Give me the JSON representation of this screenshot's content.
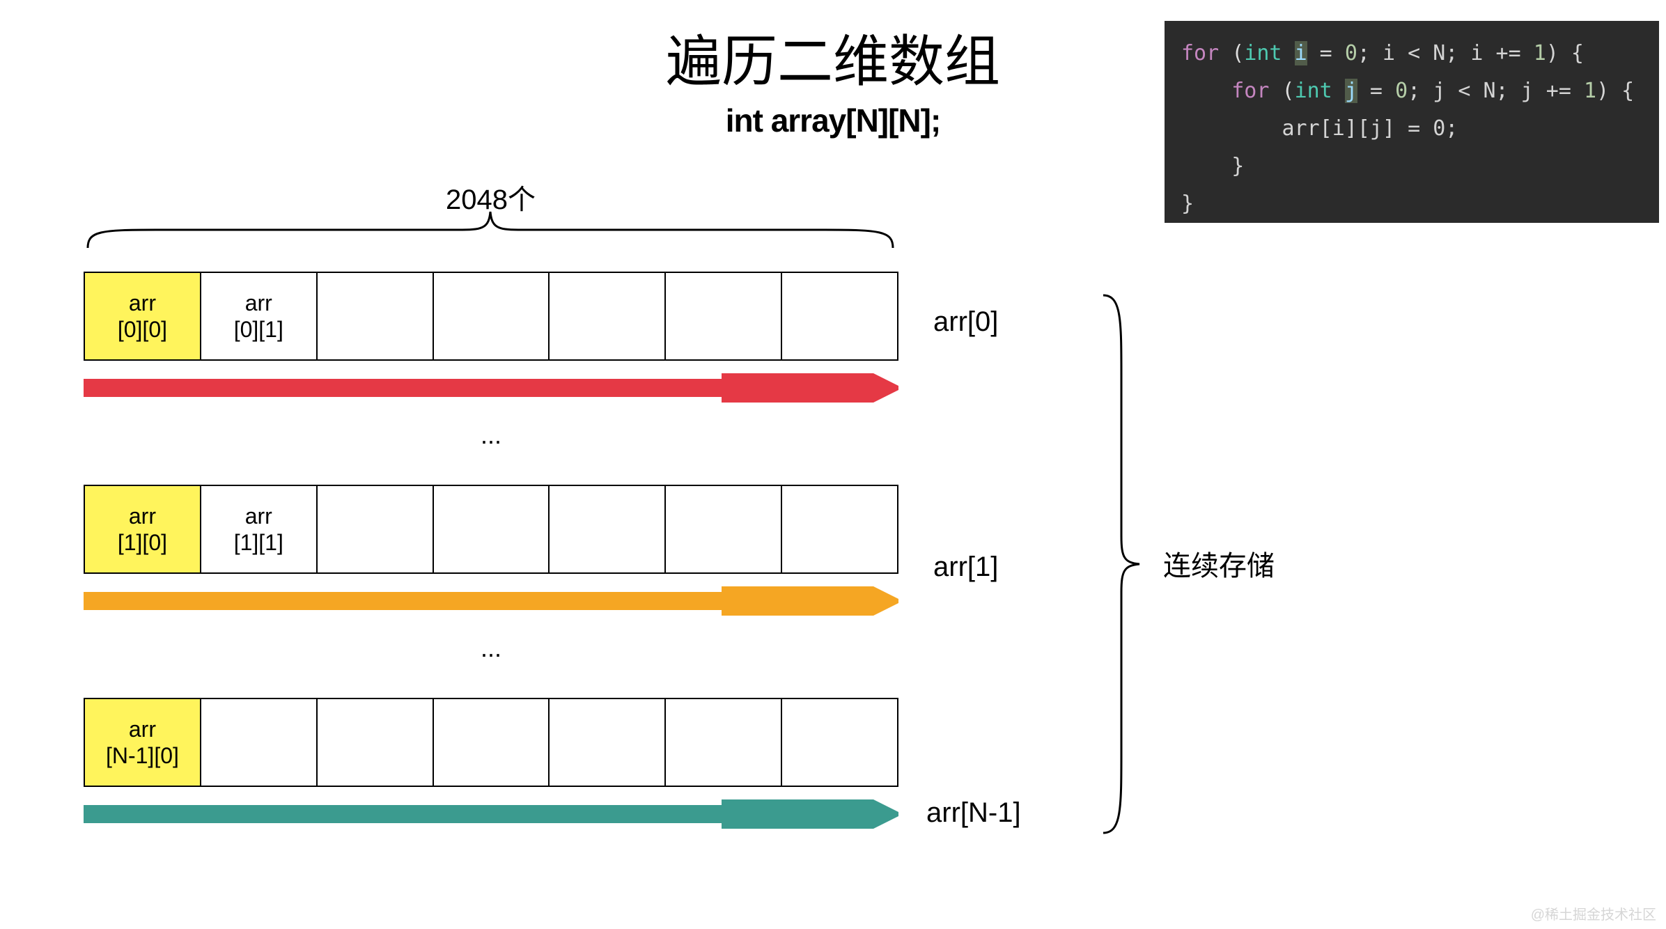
{
  "title": "遍历二维数组",
  "subtitle": "int array[N][N];",
  "size_label": "2048个",
  "storage_label": "连续存储",
  "code": {
    "line1_for": "for",
    "line1_type": "int",
    "line1_var": "i",
    "line1_eq": " = ",
    "line1_zero": "0",
    "line1_cond": "; i < N; i += ",
    "line1_one": "1",
    "line1_end": ") {",
    "line2_for": "for",
    "line2_type": "int",
    "line2_var": "j",
    "line2_eq": " = ",
    "line2_zero": "0",
    "line2_cond": "; j < N; j += ",
    "line2_one": "1",
    "line2_end": ") {",
    "line3_body": "arr[i][j] = 0;",
    "line4": "}",
    "line5": "}"
  },
  "rows": [
    {
      "cells": [
        "arr [0][0]",
        "arr [0][1]",
        "",
        "",
        "",
        "",
        ""
      ],
      "label": "arr[0]",
      "arrow_color": "#e53945"
    },
    {
      "cells": [
        "arr [1][0]",
        "arr [1][1]",
        "",
        "",
        "",
        "",
        ""
      ],
      "label": "arr[1]",
      "arrow_color": "#f5a623"
    },
    {
      "cells": [
        "arr [N-1][0]",
        "",
        "",
        "",
        "",
        "",
        ""
      ],
      "label": "arr[N-1]",
      "arrow_color": "#3b9b8f"
    }
  ],
  "dots": "...",
  "watermark": "@稀土掘金技术社区"
}
